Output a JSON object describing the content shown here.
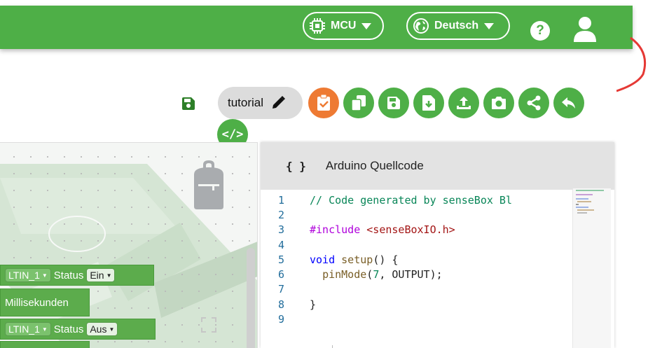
{
  "header": {
    "board_selector": "MCU",
    "language_selector": "Deutsch",
    "help_label": "?"
  },
  "toolbar": {
    "project_name": "tutorial",
    "code_toggle_label": "</>",
    "buttons": [
      "compile-icon",
      "copy-icon",
      "save-icon",
      "download-icon",
      "upload-icon",
      "screenshot-icon",
      "share-icon",
      "undo-icon"
    ]
  },
  "workspace": {
    "blocks": [
      {
        "pin": "LTIN_1",
        "status_label": "Status",
        "status_value": "Ein"
      },
      {
        "text": "Millisekunden"
      },
      {
        "pin": "LTIN_1",
        "status_label": "Status",
        "status_value": "Aus"
      }
    ]
  },
  "code_panel": {
    "bracket": "{ }",
    "title": "Arduino Quellcode",
    "lines": [
      {
        "n": "1",
        "code": "// Code generated by senseBox Bl"
      },
      {
        "n": "2",
        "code": ""
      },
      {
        "n": "3",
        "code": "#include <senseBoxIO.h>"
      },
      {
        "n": "4",
        "code": ""
      },
      {
        "n": "5",
        "code": "void setup() {"
      },
      {
        "n": "6",
        "code": "  pinMode(7, OUTPUT);"
      },
      {
        "n": "7",
        "code": ""
      },
      {
        "n": "8",
        "code": "}"
      },
      {
        "n": "9",
        "code": ""
      }
    ]
  },
  "colors": {
    "primary": "#4eaf47",
    "accent": "#ee7a33",
    "annotation": "#e53935"
  }
}
